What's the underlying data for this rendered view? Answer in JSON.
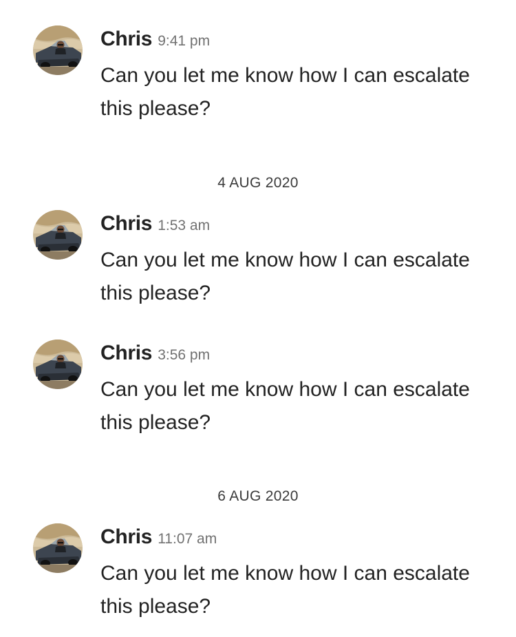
{
  "messages": [
    {
      "sender": "Chris",
      "time": "9:41 pm",
      "text": "Can you let me know how I can escalate this please?",
      "avatar_icon": "profile-photo-man-in-convertible-car"
    },
    {
      "sender": "Chris",
      "time": "1:53 am",
      "text": "Can you let me know how I can escalate this please?",
      "avatar_icon": "profile-photo-man-in-convertible-car"
    },
    {
      "sender": "Chris",
      "time": "3:56 pm",
      "text": "Can you let me know how I can escalate this please?",
      "avatar_icon": "profile-photo-man-in-convertible-car"
    },
    {
      "sender": "Chris",
      "time": "11:07 am",
      "text": "Can you let me know how I can escalate this please?",
      "avatar_icon": "profile-photo-man-in-convertible-car"
    }
  ],
  "date_separators": [
    "4 AUG 2020",
    "6 AUG 2020"
  ],
  "colors": {
    "text_primary": "#222222",
    "text_secondary": "#717171",
    "background": "#ffffff"
  }
}
